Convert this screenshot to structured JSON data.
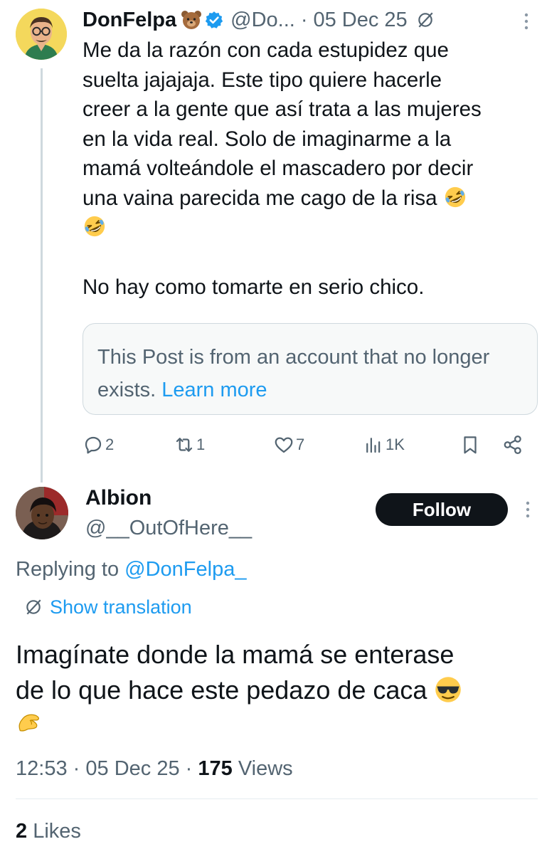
{
  "post": {
    "author_name": "DonFelpa",
    "handle": "@Do...",
    "date_sep": "·",
    "date": "05 Dec 25",
    "body_lines": [
      "Me da la razón con cada estupidez que",
      "suelta jajajaja. Este tipo quiere hacerle",
      "creer a la gente que así trata a las mujeres",
      "en la vida real. Solo de imaginarme a la",
      "mamá volteándole el mascadero por decir",
      "una vaina parecida me cago de la risa"
    ],
    "body_last": "No hay como tomarte en serio chico.",
    "quote_text": "This Post is from an account that no longer exists.",
    "quote_link": "Learn more",
    "actions": {
      "replies": "2",
      "reposts": "1",
      "likes": "7",
      "views": "1K"
    },
    "emoji": [
      "bear-emoji",
      "rolling-laughing-emoji"
    ]
  },
  "reply": {
    "author_name": "Albion",
    "handle": "@__OutOfHere__",
    "follow_label": "Follow",
    "replying_prefix": "Replying to",
    "replying_to": "@DonFelpa_",
    "show_translation": "Show translation",
    "body_line1": "Imagínate donde la mamá se enterase",
    "body_line2": "de lo que hace este pedazo de caca",
    "time": "12:53",
    "sep": "·",
    "date": "05 Dec 25",
    "views_count": "175",
    "views_label": "Views",
    "likes_count": "2",
    "likes_label": "Likes",
    "emoji": [
      "sunglasses-emoji",
      "pinching-hand-emoji"
    ]
  },
  "colors": {
    "text": "#0f1419",
    "secondary": "#536471",
    "link": "#1d9bf0",
    "border": "#cfd9de",
    "button": "#0f1419"
  }
}
